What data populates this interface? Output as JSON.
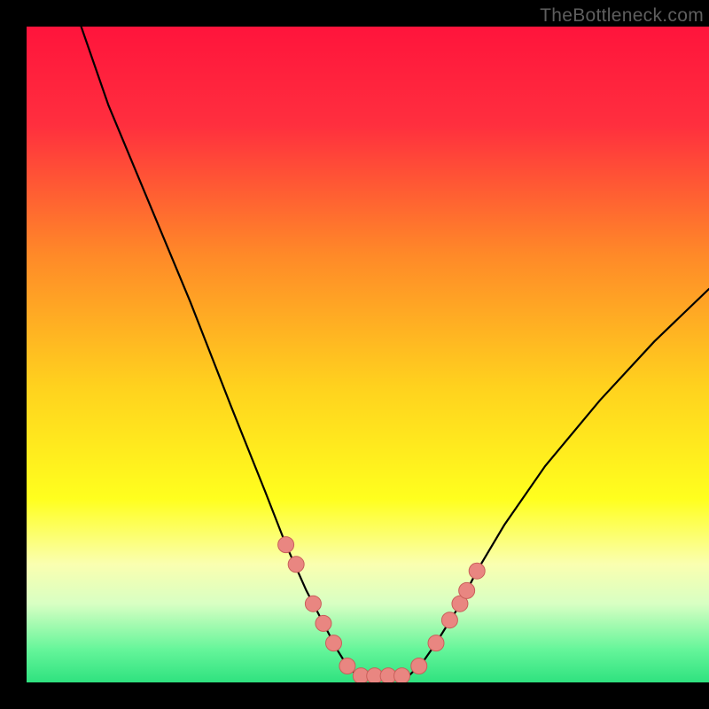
{
  "watermark": "TheBottleneck.com",
  "colors": {
    "gradient_stops": [
      {
        "offset": 0.0,
        "color": "#ff143c"
      },
      {
        "offset": 0.15,
        "color": "#ff2f3e"
      },
      {
        "offset": 0.35,
        "color": "#ff8a28"
      },
      {
        "offset": 0.55,
        "color": "#ffd21e"
      },
      {
        "offset": 0.72,
        "color": "#ffff1e"
      },
      {
        "offset": 0.82,
        "color": "#faffb0"
      },
      {
        "offset": 0.88,
        "color": "#d8ffc3"
      },
      {
        "offset": 0.95,
        "color": "#65f59a"
      },
      {
        "offset": 1.0,
        "color": "#2fe27f"
      }
    ],
    "curve": "#000000",
    "marker_fill": "#e98681",
    "marker_stroke": "#c95f5a"
  },
  "chart_data": {
    "type": "line",
    "title": "",
    "xlabel": "",
    "ylabel": "",
    "xlim": [
      0,
      100
    ],
    "ylim": [
      0,
      100
    ],
    "series": [
      {
        "name": "bottleneck-curve-left",
        "x": [
          8,
          12,
          18,
          24,
          30,
          35,
          38,
          41,
          43.5,
          45.5,
          47,
          48.5
        ],
        "y": [
          100,
          88,
          73,
          58,
          42,
          29,
          21,
          14,
          9,
          5,
          2.5,
          1
        ]
      },
      {
        "name": "bottleneck-flat",
        "x": [
          48.5,
          56
        ],
        "y": [
          1,
          1
        ]
      },
      {
        "name": "bottleneck-curve-right",
        "x": [
          56,
          58,
          60,
          63,
          66,
          70,
          76,
          84,
          92,
          100
        ],
        "y": [
          1,
          3,
          6,
          11,
          17,
          24,
          33,
          43,
          52,
          60
        ]
      }
    ],
    "markers": {
      "name": "highlighted-points",
      "points": [
        {
          "x": 38.0,
          "y": 21.0
        },
        {
          "x": 39.5,
          "y": 18.0
        },
        {
          "x": 42.0,
          "y": 12.0
        },
        {
          "x": 43.5,
          "y": 9.0
        },
        {
          "x": 45.0,
          "y": 6.0
        },
        {
          "x": 47.0,
          "y": 2.5
        },
        {
          "x": 49.0,
          "y": 1.0
        },
        {
          "x": 51.0,
          "y": 1.0
        },
        {
          "x": 53.0,
          "y": 1.0
        },
        {
          "x": 55.0,
          "y": 1.0
        },
        {
          "x": 57.5,
          "y": 2.5
        },
        {
          "x": 60.0,
          "y": 6.0
        },
        {
          "x": 62.0,
          "y": 9.5
        },
        {
          "x": 63.5,
          "y": 12.0
        },
        {
          "x": 64.5,
          "y": 14.0
        },
        {
          "x": 66.0,
          "y": 17.0
        }
      ]
    }
  }
}
